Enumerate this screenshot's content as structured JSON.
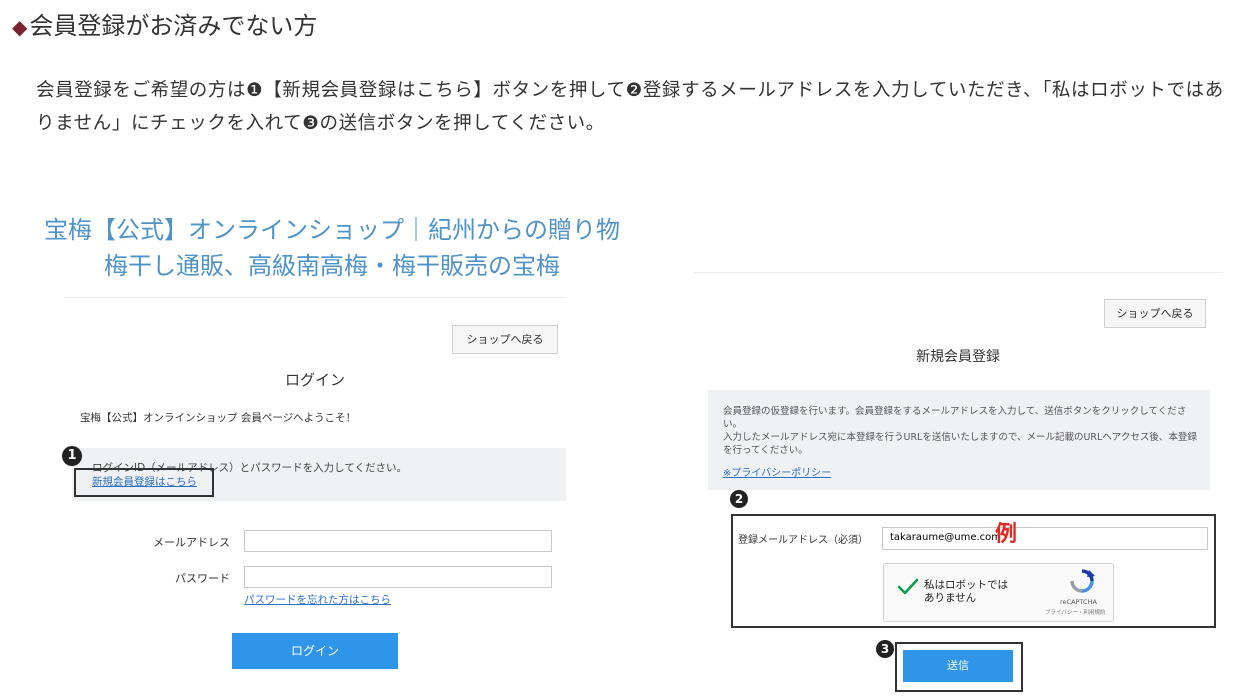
{
  "header": {
    "heading": "会員登録がお済みでない方",
    "intro": "会員登録をご希望の方は❶【新規会員登録はこちら】ボタンを押して❷登録するメールアドレスを入力していただき、「私はロボットではありません」にチェックを入れて❸の送信ボタンを押してください。"
  },
  "login_panel": {
    "shop_title": "宝梅【公式】オンラインショップ｜紀州からの贈り物 梅干し通販、高級南高梅・梅干販売の宝梅",
    "back_to_shop": "ショップへ戻る",
    "heading": "ログイン",
    "welcome": "宝梅【公式】オンラインショップ 会員ページへようこそ！",
    "instructions": "ログインID（メールアドレス）とパスワードを入力してください。",
    "register_link": "新規会員登録はこちら",
    "step_number": "1",
    "email_label": "メールアドレス",
    "password_label": "パスワード",
    "forgot_link": "パスワードを忘れた方はこちら",
    "login_button": "ログイン"
  },
  "register_panel": {
    "back_to_shop": "ショップへ戻る",
    "heading": "新規会員登録",
    "info_line1": "会員登録の仮登録を行います。会員登録をするメールアドレスを入力して、送信ボタンをクリックしてください。",
    "info_line2": "入力したメールアドレス宛に本登録を行うURLを送信いたしますので、メール記載のURLへアクセス後、本登録を行ってください。",
    "privacy_link": "※プライバシーポリシー",
    "step2_number": "2",
    "email_label": "登録メールアドレス（必須）",
    "email_value": "takaraume@ume.com",
    "example_mark": "例",
    "robot_label": "私はロボットではありません",
    "recaptcha_brand": "reCAPTCHA",
    "recaptcha_terms": "プライバシー・利用規約",
    "step3_number": "3",
    "submit_button": "送信"
  },
  "colors": {
    "accent_blue": "#2f95e8",
    "title_blue": "#4f93c7",
    "example_red": "#e42720",
    "diamond": "#7a2330",
    "check_green": "#0a9e4b"
  },
  "icons": {
    "heading_bullet": "diamond-icon",
    "captcha_check": "checkmark-icon",
    "captcha_logo": "recaptcha-icon"
  }
}
